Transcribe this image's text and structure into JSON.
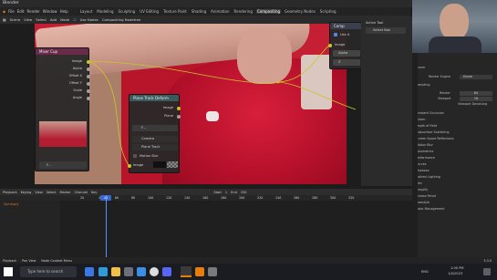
{
  "window": {
    "title": "Blender"
  },
  "menubar": {
    "menus": [
      "File",
      "Edit",
      "Render",
      "Window",
      "Help"
    ],
    "workspaces": [
      "Layout",
      "Modeling",
      "Sculpting",
      "UV Editing",
      "Texture Paint",
      "Shading",
      "Animation",
      "Rendering",
      "Compositing",
      "Geometry Nodes",
      "Scripting"
    ],
    "active_workspace": "Compositing"
  },
  "header": {
    "editor": "Scene",
    "menus": [
      "View",
      "Select",
      "Add",
      "Node"
    ],
    "use_nodes": "Use Nodes",
    "tree": "Compositing Nodetree"
  },
  "nodes": {
    "mixer": {
      "title": "Mixer Cup",
      "outputs": [
        "Image",
        "Alpha",
        "Offset X",
        "Offset Y",
        "Scale",
        "Angle"
      ],
      "footer": "F..."
    },
    "plane_track": {
      "title": "Plane Track Deform",
      "outputs": [
        "Image",
        "Plane"
      ],
      "source": "F...",
      "camera": "Camera",
      "track": "Plane Track",
      "motion_blur": "Motion Blur",
      "input": "Image"
    },
    "composite": {
      "title": "Comp",
      "use_alpha": "Use A",
      "input": "Image",
      "value": "Alpha",
      "value2": "Z"
    }
  },
  "sidebar": {
    "items": [
      "Active Tool",
      "Select Box"
    ]
  },
  "properties": {
    "scene_label": "Scene",
    "render_engine_label": "Render Engine",
    "render_engine": "Eevee",
    "sampling_label": "Sampling",
    "render_label": "Render",
    "render_value": "64",
    "viewport_label": "Viewport",
    "viewport_value": "16",
    "viewport_denoise": "Viewport Denoising",
    "sections": [
      "Ambient Occlusion",
      "Bloom",
      "Depth of Field",
      "Subsurface Scattering",
      "Screen Space Reflections",
      "Motion Blur",
      "Volumetrics",
      "Performance",
      "Curves",
      "Shadows",
      "Indirect Lighting",
      "Film",
      "Simplify",
      "Grease Pencil",
      "Freestyle",
      "Color Management"
    ]
  },
  "timeline": {
    "menus": [
      "Playback",
      "Keying",
      "View",
      "Select",
      "Marker",
      "Channel",
      "Key"
    ],
    "start_label": "Start",
    "start": "1",
    "end_label": "End",
    "end": "250",
    "current_frame": "44",
    "ticks": [
      "20",
      "40",
      "60",
      "80",
      "100",
      "120",
      "140",
      "160",
      "180",
      "200",
      "220",
      "240",
      "260",
      "280",
      "300",
      "320"
    ],
    "channel": "Summary"
  },
  "statusbar": {
    "items": [
      "Playback",
      "Pan View",
      "Node Context Menu"
    ],
    "version": "3.3.0"
  },
  "taskbar": {
    "search": "Type here to search",
    "time": "1:00 PM",
    "date": "1/4/2023",
    "tray": "ENG"
  }
}
